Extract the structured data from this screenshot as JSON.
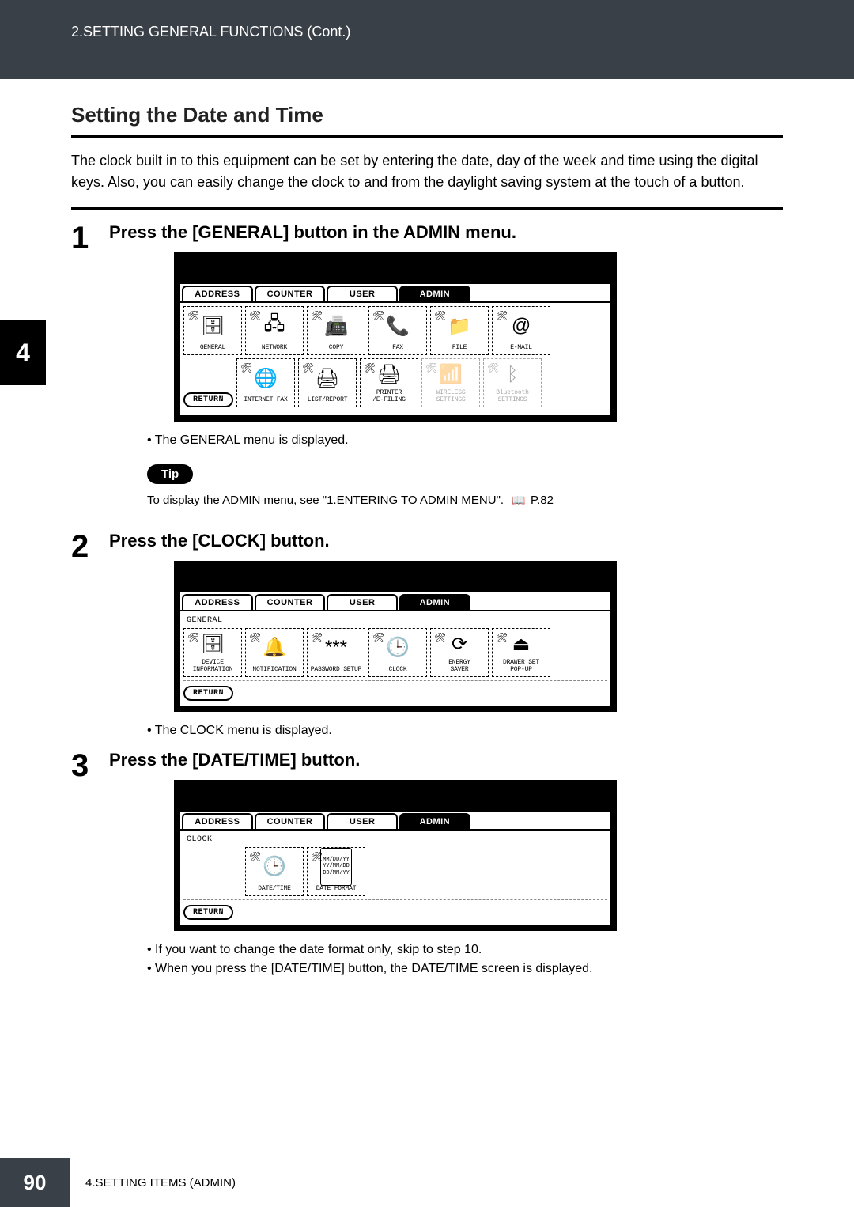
{
  "header": {
    "breadcrumb": "2.SETTING GENERAL FUNCTIONS (Cont.)"
  },
  "section": {
    "title": "Setting the Date and Time",
    "intro": "The clock built in to this equipment can be set by entering the date, day of the week and time using the digital keys.  Also, you can easily change the clock to and from the daylight saving system at the touch of a button."
  },
  "sidebar_num": "4",
  "steps": [
    {
      "num": "1",
      "title": "Press the [GENERAL] button in the ADMIN menu.",
      "bullets": [
        "The GENERAL menu is displayed."
      ],
      "tip_label": "Tip",
      "tip_text_a": "To display the ADMIN menu, see \"1.ENTERING TO ADMIN MENU\".",
      "tip_text_b": "P.82"
    },
    {
      "num": "2",
      "title": "Press the [CLOCK] button.",
      "bullets": [
        "The CLOCK menu is displayed."
      ]
    },
    {
      "num": "3",
      "title": "Press the [DATE/TIME] button.",
      "bullets": [
        "If you want to change the date format only, skip to step 10.",
        "When you press the [DATE/TIME] button, the DATE/TIME screen is displayed."
      ]
    }
  ],
  "screens": {
    "tabs": [
      "ADDRESS",
      "COUNTER",
      "USER",
      "ADMIN"
    ],
    "return_label": "RETURN",
    "admin_row1": [
      {
        "label": "GENERAL",
        "glyph": "🗄"
      },
      {
        "label": "NETWORK",
        "glyph": "🖧"
      },
      {
        "label": "COPY",
        "glyph": "📠"
      },
      {
        "label": "FAX",
        "glyph": "📞"
      },
      {
        "label": "FILE",
        "glyph": "📁"
      },
      {
        "label": "E-MAIL",
        "glyph": "@"
      }
    ],
    "admin_row2": [
      {
        "label": "INTERNET FAX",
        "glyph": "🌐"
      },
      {
        "label": "LIST/REPORT",
        "glyph": "🖨"
      },
      {
        "label": "PRINTER\n/E-FILING",
        "glyph": "🖨"
      },
      {
        "label": "WIRELESS\nSETTINGS",
        "glyph": "📶",
        "dim": true
      },
      {
        "label": "Bluetooth\nSETTINGS",
        "glyph": "ᛒ",
        "dim": true
      }
    ],
    "general_label": "GENERAL",
    "general_row": [
      {
        "label": "DEVICE\nINFORMATION",
        "glyph": "🗄"
      },
      {
        "label": "NOTIFICATION",
        "glyph": "🔔"
      },
      {
        "label": "PASSWORD SETUP",
        "glyph": "***"
      },
      {
        "label": "CLOCK",
        "glyph": "🕒"
      },
      {
        "label": "ENERGY\nSAVER",
        "glyph": "⟳"
      },
      {
        "label": "DRAWER SET\nPOP-UP",
        "glyph": "⏏"
      }
    ],
    "clock_label": "CLOCK",
    "clock_row": [
      {
        "label": "DATE/TIME",
        "glyph": "🕒"
      },
      {
        "label": "DATE FORMAT",
        "glyph": "MM/DD/YY\nYY/MM/DD\nDD/MM/YY",
        "small": true
      }
    ]
  },
  "footer": {
    "page": "90",
    "text": "4.SETTING ITEMS (ADMIN)"
  }
}
